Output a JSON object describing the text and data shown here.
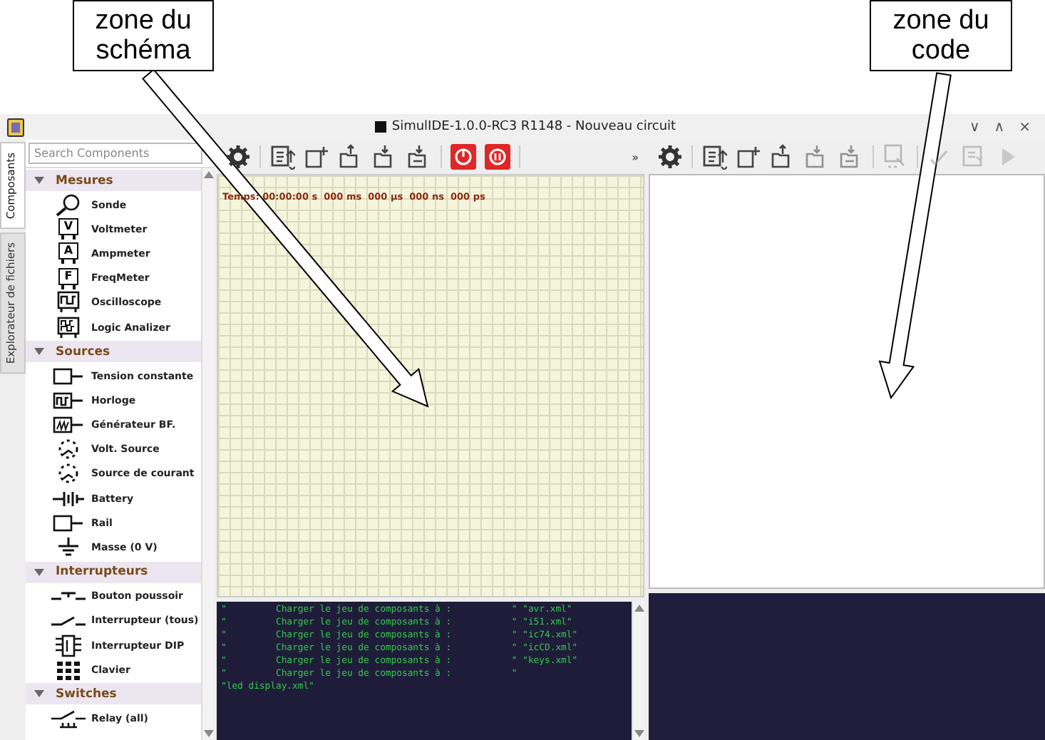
{
  "annotations": [
    {
      "text": "zone du schéma"
    },
    {
      "text": "zone du code"
    }
  ],
  "window": {
    "title": "SimulIDE-1.0.0-RC3 R1148 - Nouveau circuit",
    "controls": [
      "∨",
      "∧",
      "×"
    ]
  },
  "side_tabs": [
    {
      "label": "Composants",
      "selected": true
    },
    {
      "label": "Explorateur de fichiers",
      "selected": false
    }
  ],
  "search": {
    "placeholder": "Search Components"
  },
  "categories": [
    {
      "name": "Mesures",
      "expanded": true,
      "items": [
        {
          "label": "Sonde"
        },
        {
          "label": "Voltmeter",
          "symbol": "V"
        },
        {
          "label": "Ampmeter",
          "symbol": "A"
        },
        {
          "label": "FreqMeter",
          "symbol": "F"
        },
        {
          "label": "Oscilloscope"
        },
        {
          "label": "Logic Analizer"
        }
      ]
    },
    {
      "name": "Sources",
      "expanded": true,
      "items": [
        {
          "label": "Tension constante"
        },
        {
          "label": "Horloge"
        },
        {
          "label": "Générateur BF."
        },
        {
          "label": "Volt. Source"
        },
        {
          "label": "Source de courant"
        },
        {
          "label": "Battery"
        },
        {
          "label": "Rail"
        },
        {
          "label": "Masse (0 V)"
        }
      ]
    },
    {
      "name": "Interrupteurs",
      "expanded": true,
      "items": [
        {
          "label": "Bouton poussoir"
        },
        {
          "label": "Interrupteur (tous)"
        },
        {
          "label": "Interrupteur DIP"
        },
        {
          "label": "Clavier"
        }
      ]
    },
    {
      "name": "Switches",
      "expanded": true,
      "items": [
        {
          "label": "Relay (all)"
        }
      ]
    }
  ],
  "circuit": {
    "expand_mark": "»",
    "time": "Temps: 00:00:00 s  000 ms  000 µs  000 ns  000 ps"
  },
  "log": [
    "\"         Charger le jeu de composants à :           \" \"avr.xml\"",
    "\"         Charger le jeu de composants à :           \" \"i51.xml\"",
    "\"         Charger le jeu de composants à :           \" \"ic74.xml\"",
    "\"         Charger le jeu de composants à :           \" \"icCD.xml\"",
    "\"         Charger le jeu de composants à :           \" \"keys.xml\"",
    "\"         Charger le jeu de composants à :           \"",
    "\"led display.xml\""
  ]
}
